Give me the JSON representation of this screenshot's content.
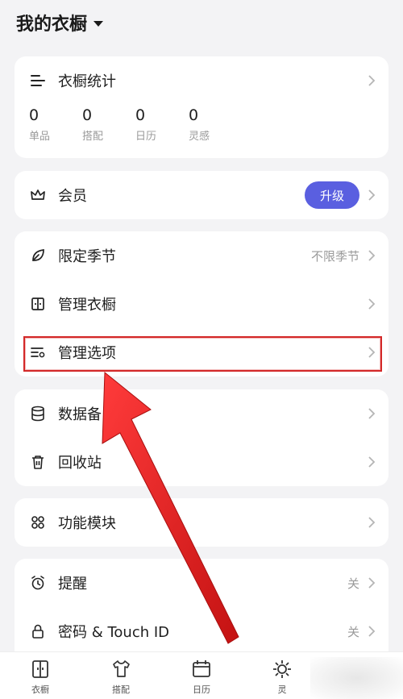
{
  "header": {
    "title": "我的衣橱"
  },
  "stats_card": {
    "title": "衣橱统计",
    "stats": [
      {
        "value": "0",
        "label": "单品"
      },
      {
        "value": "0",
        "label": "搭配"
      },
      {
        "value": "0",
        "label": "日历"
      },
      {
        "value": "0",
        "label": "灵感"
      }
    ]
  },
  "member": {
    "label": "会员",
    "button": "升级"
  },
  "group1": [
    {
      "label": "限定季节",
      "value": "不限季节"
    },
    {
      "label": "管理衣橱"
    },
    {
      "label": "管理选项"
    }
  ],
  "group2": [
    {
      "label": "数据备"
    },
    {
      "label": "回收站"
    }
  ],
  "modules": {
    "label": "功能模块"
  },
  "group3": [
    {
      "label": "提醒",
      "value": "关"
    },
    {
      "label": "密码 & Touch ID",
      "value": "关"
    }
  ],
  "tabbar": [
    {
      "label": "衣橱",
      "icon": "wardrobe-icon"
    },
    {
      "label": "搭配",
      "icon": "outfit-icon"
    },
    {
      "label": "日历",
      "icon": "calendar-icon"
    },
    {
      "label": "灵",
      "icon": "inspiration-icon"
    }
  ],
  "colors": {
    "accent": "#5a5fe0",
    "annotation": "#e31c1c",
    "background": "#f3f3f5"
  }
}
